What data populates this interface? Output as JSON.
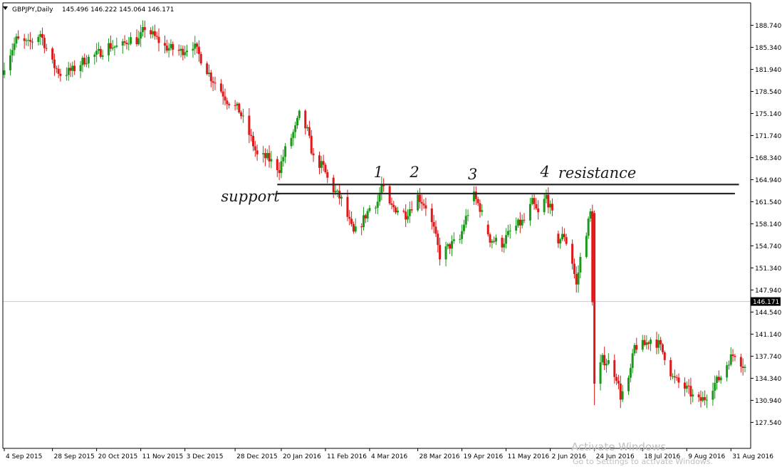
{
  "header": {
    "symbol": "GBPJPY,Daily",
    "ohlc": "145.496 146.222 145.064 146.171",
    "dropdown_icon": "triangle-down-icon"
  },
  "current_price_label": "146.171",
  "watermark": {
    "line1": "Activate Windows",
    "line2": "Go to Settings to activate Windows."
  },
  "colors": {
    "bull": "#1a9a1a",
    "bear": "#e01818",
    "line": "#2a2a2a",
    "grid": "#c8c8c8"
  },
  "chart_data": {
    "type": "candlestick",
    "title": "GBPJPY,Daily",
    "xlabel": "",
    "ylabel": "",
    "ylim": [
      127.54,
      190.4
    ],
    "y_ticks": [
      "188.740",
      "185.340",
      "181.940",
      "178.540",
      "175.140",
      "171.740",
      "168.340",
      "164.940",
      "161.540",
      "158.140",
      "154.740",
      "151.340",
      "147.940",
      "144.540",
      "141.140",
      "137.740",
      "134.340",
      "130.940",
      "127.540"
    ],
    "x_ticks": [
      "4 Sep 2015",
      "28 Sep 2015",
      "20 Oct 2015",
      "11 Nov 2015",
      "3 Dec 2015",
      "28 Dec 2015",
      "20 Jan 2016",
      "11 Feb 2016",
      "4 Mar 2016",
      "28 Mar 2016",
      "19 Apr 2016",
      "11 May 2016",
      "2 Jun 2016",
      "24 Jun 2016",
      "18 Jul 2016",
      "9 Aug 2016",
      "31 Aug 2016"
    ],
    "period": {
      "start": "2015-09-04",
      "end": "2016-09-07"
    },
    "close_path": [
      [
        "2015-09-04",
        182.6
      ],
      [
        "2015-09-10",
        186.5
      ],
      [
        "2015-09-16",
        185.8
      ],
      [
        "2015-09-22",
        187.5
      ],
      [
        "2015-09-28",
        182.8
      ],
      [
        "2015-10-02",
        181.2
      ],
      [
        "2015-10-08",
        181.8
      ],
      [
        "2015-10-14",
        183.4
      ],
      [
        "2015-10-20",
        184.2
      ],
      [
        "2015-10-26",
        185.6
      ],
      [
        "2015-11-01",
        185.3
      ],
      [
        "2015-11-05",
        186.6
      ],
      [
        "2015-11-10",
        186.4
      ],
      [
        "2015-11-13",
        188.4
      ],
      [
        "2015-11-17",
        187.2
      ],
      [
        "2015-11-23",
        185.4
      ],
      [
        "2015-12-01",
        184.7
      ],
      [
        "2015-12-07",
        185.8
      ],
      [
        "2015-12-11",
        183.6
      ],
      [
        "2015-12-16",
        180.7
      ],
      [
        "2015-12-21",
        178.7
      ],
      [
        "2015-12-24",
        177.2
      ],
      [
        "2015-12-30",
        175.6
      ],
      [
        "2016-01-05",
        171.2
      ],
      [
        "2016-01-08",
        168.6
      ],
      [
        "2016-01-13",
        168.3
      ],
      [
        "2016-01-19",
        166.6
      ],
      [
        "2016-01-22",
        169.5
      ],
      [
        "2016-01-27",
        172.8
      ],
      [
        "2016-01-29",
        174.9
      ],
      [
        "2016-02-02",
        172.4
      ],
      [
        "2016-02-05",
        168.2
      ],
      [
        "2016-02-10",
        166.8
      ],
      [
        "2016-02-13",
        164.2
      ],
      [
        "2016-02-19",
        161.8
      ],
      [
        "2016-02-25",
        156.6
      ],
      [
        "2016-02-29",
        158.3
      ],
      [
        "2016-03-04",
        160.6
      ],
      [
        "2016-03-08",
        161.6
      ],
      [
        "2016-03-10",
        164.0
      ],
      [
        "2016-03-14",
        160.8
      ],
      [
        "2016-03-18",
        160.4
      ],
      [
        "2016-03-22",
        159.6
      ],
      [
        "2016-03-28",
        162.4
      ],
      [
        "2016-04-01",
        160.9
      ],
      [
        "2016-04-05",
        157.2
      ],
      [
        "2016-04-08",
        153.2
      ],
      [
        "2016-04-13",
        154.8
      ],
      [
        "2016-04-18",
        155.7
      ],
      [
        "2016-04-20",
        158.2
      ],
      [
        "2016-04-25",
        162.4
      ],
      [
        "2016-04-28",
        160.6
      ],
      [
        "2016-05-03",
        155.8
      ],
      [
        "2016-05-09",
        155.1
      ],
      [
        "2016-05-13",
        156.9
      ],
      [
        "2016-05-17",
        158.0
      ],
      [
        "2016-05-20",
        158.6
      ],
      [
        "2016-05-24",
        161.4
      ],
      [
        "2016-05-27",
        159.6
      ],
      [
        "2016-05-31",
        162.4
      ],
      [
        "2016-06-03",
        159.5
      ],
      [
        "2016-06-06",
        155.6
      ],
      [
        "2016-06-09",
        156.4
      ],
      [
        "2016-06-13",
        152.2
      ],
      [
        "2016-06-15",
        148.6
      ],
      [
        "2016-06-17",
        152.8
      ],
      [
        "2016-06-22",
        159.8
      ],
      [
        "2016-06-24",
        133.5
      ],
      [
        "2016-06-28",
        137.2
      ],
      [
        "2016-07-01",
        136.8
      ],
      [
        "2016-07-05",
        134.6
      ],
      [
        "2016-07-07",
        131.6
      ],
      [
        "2016-07-11",
        133.8
      ],
      [
        "2016-07-14",
        139.2
      ],
      [
        "2016-07-19",
        139.5
      ],
      [
        "2016-07-22",
        140.4
      ],
      [
        "2016-07-26",
        139.6
      ],
      [
        "2016-07-29",
        137.8
      ],
      [
        "2016-08-02",
        134.4
      ],
      [
        "2016-08-05",
        133.6
      ],
      [
        "2016-08-10",
        132.4
      ],
      [
        "2016-08-14",
        130.6
      ],
      [
        "2016-08-18",
        131.3
      ],
      [
        "2016-08-22",
        133.2
      ],
      [
        "2016-08-26",
        134.6
      ],
      [
        "2016-08-30",
        137.2
      ],
      [
        "2016-09-02",
        138.2
      ],
      [
        "2016-09-07",
        136.0
      ]
    ],
    "resistance_line": {
      "value": 164.2,
      "from": "2016-01-18",
      "to": "2016-09-04"
    },
    "support_line": {
      "value": 162.8,
      "from": "2016-01-18",
      "to": "2016-09-02"
    },
    "current_price": 146.171,
    "annotations": [
      {
        "text": "1",
        "date": "2016-03-06",
        "price": 165.3
      },
      {
        "text": "2",
        "date": "2016-03-24",
        "price": 165.3
      },
      {
        "text": "3",
        "date": "2016-04-22",
        "price": 165.0
      },
      {
        "text": "4",
        "date": "2016-05-28",
        "price": 165.4
      },
      {
        "text": "resistance",
        "date": "2016-06-06",
        "price": 165.2
      },
      {
        "text": "support",
        "date": "2015-12-21",
        "price": 161.6
      }
    ]
  }
}
